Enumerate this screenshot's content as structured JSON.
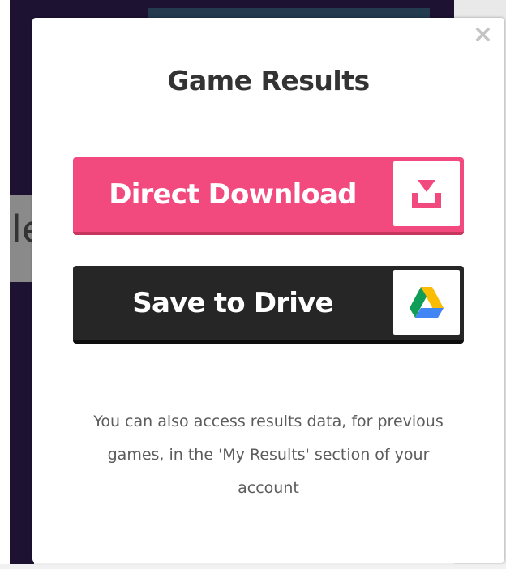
{
  "modal": {
    "title": "Game Results",
    "close_glyph": "×",
    "buttons": [
      {
        "label": "Direct Download",
        "icon": "download-icon",
        "color": "#f2497e"
      },
      {
        "label": "Save to Drive",
        "icon": "google-drive-icon",
        "color": "#262626"
      }
    ],
    "info_text": "You can also access results data, for previous games, in the 'My Results' section of your account"
  },
  "background": {
    "peek_text": "le"
  }
}
